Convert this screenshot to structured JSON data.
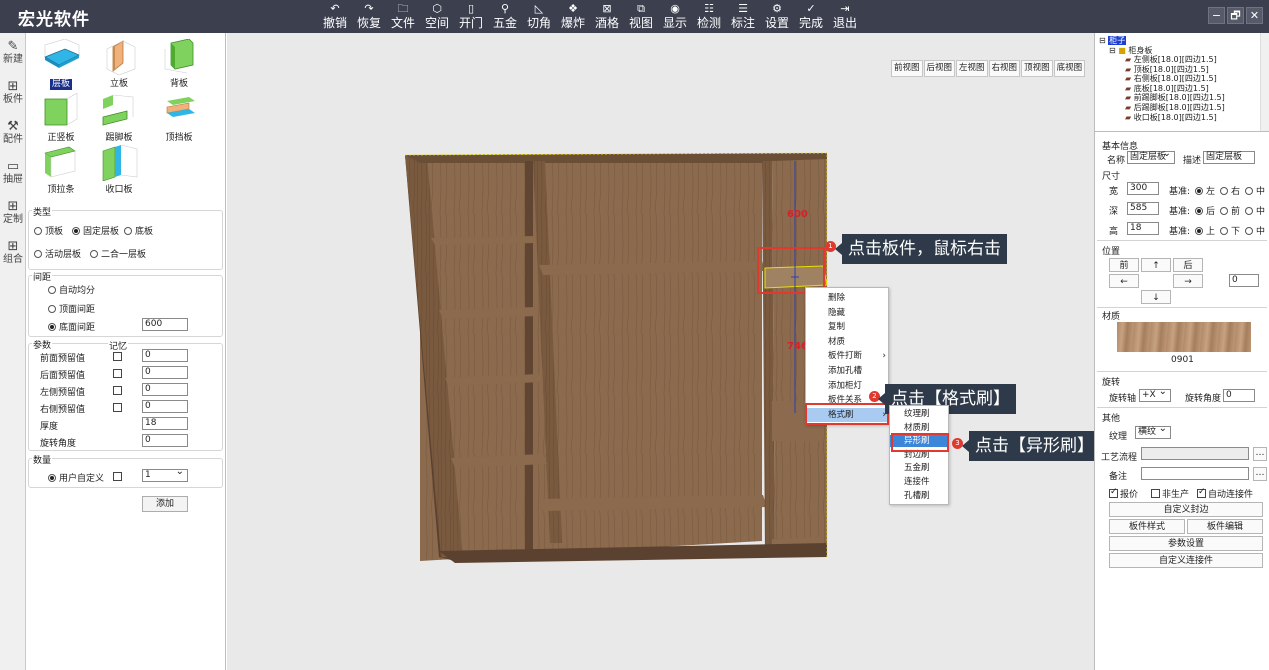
{
  "app": {
    "title": "宏光软件",
    "window_controls": [
      "−",
      "🗗",
      "✕"
    ]
  },
  "toolbar": [
    {
      "icon": "↶",
      "label": "撤销",
      "name": "undo"
    },
    {
      "icon": "↷",
      "label": "恢复",
      "name": "redo"
    },
    {
      "icon": "🗀",
      "label": "文件",
      "name": "file"
    },
    {
      "icon": "⬡",
      "label": "空间",
      "name": "space"
    },
    {
      "icon": "▯",
      "label": "开门",
      "name": "door"
    },
    {
      "icon": "⚲",
      "label": "五金",
      "name": "hardware"
    },
    {
      "icon": "◺",
      "label": "切角",
      "name": "chamfer"
    },
    {
      "icon": "❖",
      "label": "爆炸",
      "name": "explode"
    },
    {
      "icon": "⊠",
      "label": "酒格",
      "name": "wine-rack"
    },
    {
      "icon": "⧉",
      "label": "视图",
      "name": "view"
    },
    {
      "icon": "◉",
      "label": "显示",
      "name": "display"
    },
    {
      "icon": "☷",
      "label": "检测",
      "name": "detect"
    },
    {
      "icon": "☰",
      "label": "标注",
      "name": "annotate"
    },
    {
      "icon": "⚙",
      "label": "设置",
      "name": "settings"
    },
    {
      "icon": "✓",
      "label": "完成",
      "name": "finish"
    },
    {
      "icon": "⇥",
      "label": "退出",
      "name": "exit"
    }
  ],
  "rail": [
    {
      "icon": "✎",
      "label": "新建",
      "name": "new"
    },
    {
      "icon": "⊞",
      "label": "板件",
      "name": "panel"
    },
    {
      "icon": "⚒",
      "label": "配件",
      "name": "accessory"
    },
    {
      "icon": "▭",
      "label": "抽屉",
      "name": "drawer"
    },
    {
      "icon": "⊞",
      "label": "定制",
      "name": "custom"
    },
    {
      "icon": "⊞",
      "label": "组合",
      "name": "combine"
    }
  ],
  "left_panel": {
    "tiles": [
      "层板",
      "立板",
      "背板",
      "正竖板",
      "踢脚板",
      "顶挡板",
      "顶拉条",
      "收口板"
    ],
    "selected_tile": "层板",
    "type_group": {
      "title": "类型",
      "options": [
        "顶板",
        "固定层板",
        "底板",
        "活动层板",
        "二合一层板"
      ],
      "selected": "固定层板"
    },
    "spacing_group": {
      "title": "间距",
      "options": [
        "自动均分",
        "顶面间距",
        "底面间距"
      ],
      "selected": "底面间距",
      "value": "600"
    },
    "params_group": {
      "title": "参数",
      "memory_label": "记忆",
      "rows": [
        {
          "label": "前面预留值",
          "value": "0",
          "checkbox": true
        },
        {
          "label": "后面预留值",
          "value": "0",
          "checkbox": true
        },
        {
          "label": "左侧预留值",
          "value": "0",
          "checkbox": true
        },
        {
          "label": "右侧预留值",
          "value": "0",
          "checkbox": true
        },
        {
          "label": "厚度",
          "value": "18",
          "checkbox": false
        },
        {
          "label": "旋转角度",
          "value": "0",
          "checkbox": false
        }
      ]
    },
    "qty_group": {
      "title": "数量",
      "option": "用户自定义",
      "value": "1"
    },
    "add_button": "添加"
  },
  "viewport": {
    "view_buttons": [
      "前视图",
      "后视图",
      "左视图",
      "右视图",
      "顶视图",
      "底视图"
    ],
    "dim_top": "600",
    "dim_bottom": "746",
    "context_menu": [
      "删除",
      "隐藏",
      "复制",
      "材质",
      "板件打断",
      "添加孔槽",
      "添加柜灯",
      "板件关系",
      "格式刷"
    ],
    "context_submenu_items": [
      "板件打断",
      "格式刷"
    ],
    "highlighted_menu": "格式刷",
    "submenu": [
      "纹理刷",
      "材质刷",
      "异形刷",
      "封边刷",
      "五金刷",
      "连接件",
      "孔槽刷"
    ],
    "highlighted_sub": "异形刷",
    "steps": [
      {
        "num": "1",
        "text": "点击板件，鼠标右击"
      },
      {
        "num": "2",
        "text": "点击【格式刷】"
      },
      {
        "num": "3",
        "text": "点击【异形刷】"
      }
    ],
    "colors": {
      "wood": "#7a5a3f",
      "wood_dark": "#5b4130",
      "accent_red": "#e2392e",
      "callout_bg": "#2e3a4a"
    }
  },
  "tree": {
    "root": "柜子",
    "body": "柜身板",
    "items": [
      "左侧板[18.0][四边1.5]",
      "顶板[18.0][四边1.5]",
      "右侧板[18.0][四边1.5]",
      "底板[18.0][四边1.5]",
      "前踢脚板[18.0][四边1.5]",
      "后踢脚板[18.0][四边1.5]",
      "收口板[18.0][四边1.5]"
    ]
  },
  "props": {
    "basic_title": "基本信息",
    "name_label": "名称",
    "name_value": "固定层板",
    "desc_label": "描述",
    "desc_value": "固定层板",
    "size_title": "尺寸",
    "dims": [
      {
        "label": "宽",
        "value": "300",
        "base": "基准:",
        "opts": [
          "左",
          "右",
          "中"
        ],
        "sel": "左"
      },
      {
        "label": "深",
        "value": "585",
        "base": "基准:",
        "opts": [
          "后",
          "前",
          "中"
        ],
        "sel": "后"
      },
      {
        "label": "高",
        "value": "18",
        "base": "基准:",
        "opts": [
          "上",
          "下",
          "中"
        ],
        "sel": "上"
      }
    ],
    "pos_title": "位置",
    "pos_buttons": [
      "前",
      "↑",
      "后",
      "←",
      "→",
      "↓"
    ],
    "pos_value": "0",
    "material_title": "材质",
    "material_code": "0901",
    "rotate_title": "旋转",
    "rotate_axis_label": "旋转轴",
    "rotate_axis_value": "+X",
    "rotate_angle_label": "旋转角度",
    "rotate_angle_value": "0",
    "other_title": "其他",
    "grain_label": "纹理",
    "grain_value": "横纹",
    "process_label": "工艺流程",
    "note_label": "备注",
    "checks": [
      {
        "label": "报价",
        "on": true
      },
      {
        "label": "非生产",
        "on": false
      },
      {
        "label": "自动连接件",
        "on": true
      }
    ],
    "buttons": [
      "自定义封边",
      "板件样式",
      "板件编辑",
      "参数设置",
      "自定义连接件"
    ]
  }
}
